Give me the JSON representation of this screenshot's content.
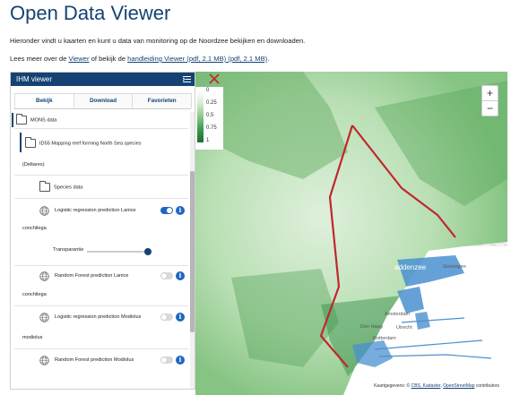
{
  "page": {
    "title": "Open Data Viewer",
    "intro": "Hieronder vindt u kaarten en kunt u data van monitoring op de Noordzee bekijken en downloaden.",
    "more_prefix": "Lees meer over de ",
    "more_viewer_link": "Viewer",
    "more_middle": " of bekijk de ",
    "more_manual_link": "handleiding Viewer (pdf, 2.1 MB) (pdf, 2.1 MB)",
    "more_suffix": "."
  },
  "panel": {
    "header": "IHM viewer",
    "tabs": [
      "Bekijk",
      "Download",
      "Favorieten"
    ],
    "active_tab": "Bekijk",
    "items": {
      "mons": "MONS data",
      "id55": "ID55 Mapping reef forming North Sea species",
      "deltares": "(Deltares)",
      "species": "Species data",
      "lr_lanice_1": "Logistic regression prediction Lanice",
      "lr_lanice_2": "conchilega",
      "transparency": "Transparantie",
      "rf_lanice_1": "Random Forest prediction Lanice",
      "rf_lanice_2": "conchilega",
      "lr_mod_1": "Logistic regression prediction Modiolus",
      "lr_mod_2": "modiolus",
      "rf_mod_1": "Random Forest prediction Modiolus"
    },
    "toggles": {
      "lr_lanice": true,
      "rf_lanice": false,
      "lr_mod": false,
      "rf_mod": false
    },
    "transparency_value": 1.0
  },
  "legend": {
    "ticks": [
      "0",
      "0.25",
      "0.5",
      "0.75",
      "1"
    ]
  },
  "map": {
    "zoom_in": "+",
    "zoom_out": "−",
    "attribution_prefix": "Kaartgegevens: © ",
    "attribution_kadaster": "CBS, Kadaster",
    "attribution_mid": ", ",
    "attribution_osm": "OpenStreetMap",
    "attribution_suffix": " contributors",
    "places": {
      "sea": "addenzee",
      "groningen": "Groningen",
      "amsterdam": "Amsterdam",
      "utrecht": "Utrecht",
      "rotterdam": "Rotterdam",
      "den_haag": "Den Haag"
    }
  },
  "colors": {
    "brand": "#154273",
    "accent_blue": "#1f66c2",
    "boundary_red": "#c0272d",
    "sea_green": "#3a9a4e"
  }
}
